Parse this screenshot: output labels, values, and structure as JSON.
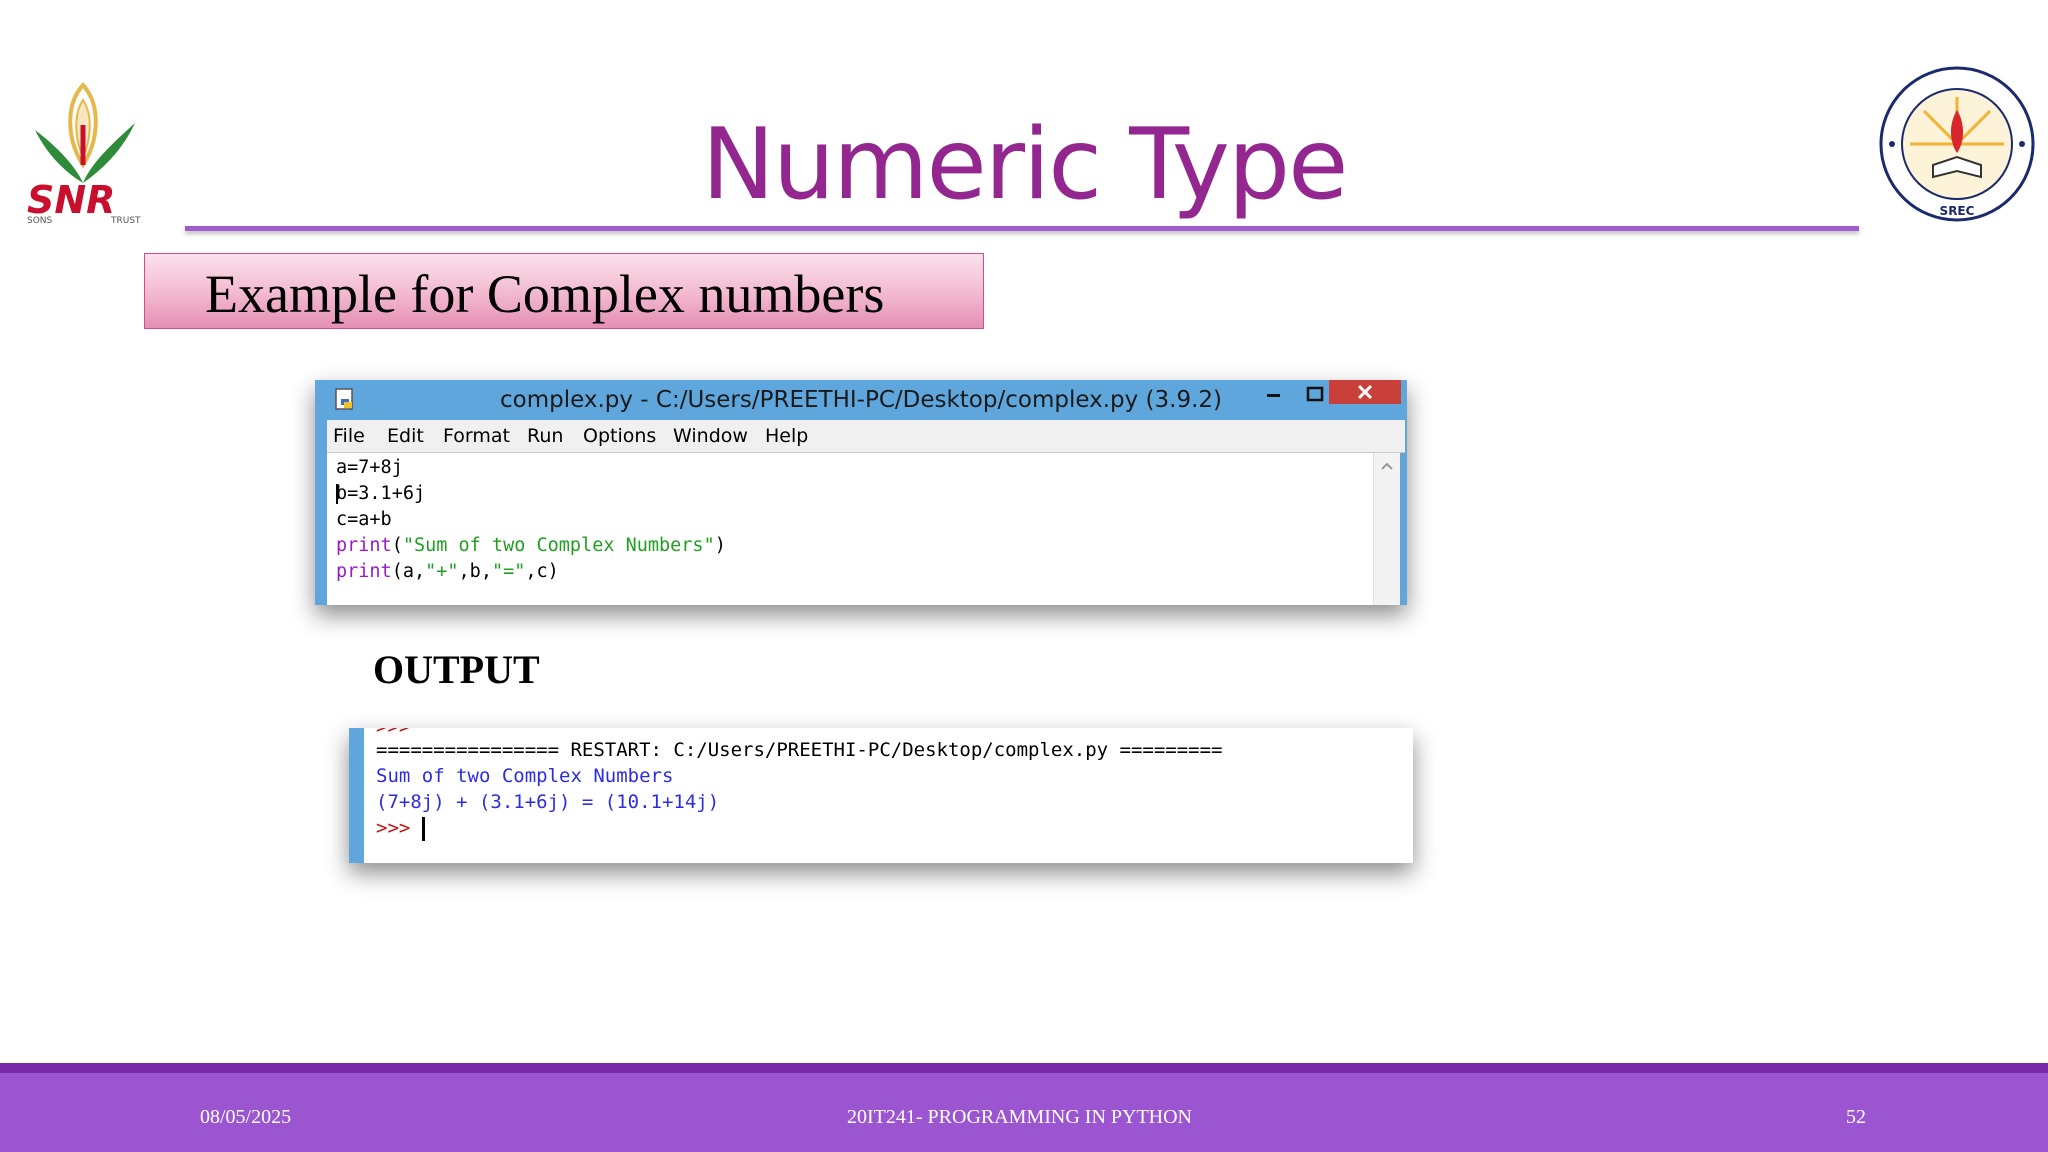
{
  "slide": {
    "title": "Numeric Type",
    "subtitle": "Example for Complex numbers",
    "output_label": "OUTPUT"
  },
  "logos": {
    "left": {
      "text": "SNR",
      "sub_left": "SONS",
      "sub_right": "TRUST"
    },
    "right": {
      "ring_text": "ENLIGHTENMENT THROUGH EDUCATION",
      "bottom_text": "SREC"
    }
  },
  "editor": {
    "title": "complex.py - C:/Users/PREETHI-PC/Desktop/complex.py (3.9.2)",
    "menu": [
      "File",
      "Edit",
      "Format",
      "Run",
      "Options",
      "Window",
      "Help"
    ],
    "code": {
      "line1": "a=7+8j",
      "line2": "b=3.1+6j",
      "line3": "c=a+b",
      "line4_fn": "print",
      "line4_open": "(",
      "line4_str": "\"Sum of two Complex Numbers\"",
      "line4_close": ")",
      "line5_fn": "print",
      "line5_a": "(a,",
      "line5_s1": "\"+\"",
      "line5_b": ",b,",
      "line5_s2": "\"=\"",
      "line5_c": ",c)"
    }
  },
  "shell": {
    "prompt_top": ">>>",
    "restart_line": "================ RESTART: C:/Users/PREETHI-PC/Desktop/complex.py =========",
    "output1": "Sum of two Complex Numbers",
    "output2": "(7+8j) + (3.1+6j) = (10.1+14j)",
    "prompt": ">>>"
  },
  "footer": {
    "date": "08/05/2025",
    "course": "20IT241- PROGRAMMING IN PYTHON",
    "page": "52"
  },
  "colors": {
    "title": "#93278f",
    "footer": "#9b55d1",
    "window_frame": "#5fa6dc",
    "keyword": "#9a1bc8",
    "string": "#20a020",
    "shell_output": "#2d2de0",
    "shell_prompt": "#c01010"
  }
}
